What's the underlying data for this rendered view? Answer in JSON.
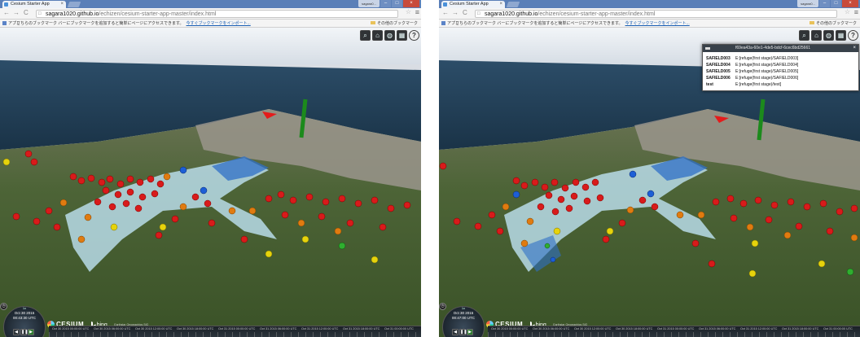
{
  "screens": [
    {
      "id": "left",
      "tab": {
        "title": "Cesium Starter App"
      },
      "window": {
        "user_label": "sagara0..."
      },
      "address": {
        "host": "sagara1020.github.io",
        "path": "/echizen/cesium-starter-app-master/index.html"
      },
      "bookmarks": {
        "apps": "アプリ",
        "message": "こちらのブックマーク バーにブックマークを追加すると簡単にページにアクセスできます。",
        "import_link": "今すぐブックマークをインポート...",
        "other": "その他のブックマーク"
      },
      "clock": {
        "speed": "1x",
        "date": "Oct 30 2015",
        "time": "00:43:30 UTC"
      },
      "credits": {
        "cesium": "CESIUM",
        "bing": "bing",
        "text": "Earthstar Geographics SIO"
      },
      "timeline_labels": [
        "Oct 30 2015 00:00:00 UTC",
        "Oct 30 2015 06:00:00 UTC",
        "Oct 30 2015 12:00:00 UTC",
        "Oct 30 2015 18:00:00 UTC",
        "Oct 31 2015 00:00:00 UTC",
        "Oct 31 2015 06:00:00 UTC",
        "Oct 31 2015 12:00:00 UTC",
        "Oct 31 2015 18:00:00 UTC",
        "Oct 31 00:00:00 UTC"
      ]
    },
    {
      "id": "right",
      "tab": {
        "title": "Cesium Starter App"
      },
      "window": {
        "user_label": "sagara0..."
      },
      "address": {
        "host": "sagara1020.github.io",
        "path": "/echizen/cesium-starter-app-master/index.html"
      },
      "bookmarks": {
        "apps": "アプリ",
        "message": "こちらのブックマーク バーにブックマークを追加すると簡単にページにアクセスできます。",
        "import_link": "今すぐブックマークをインポート...",
        "other": "その他のブックマーク"
      },
      "infobox": {
        "title": "f69ea43a-60e1-4de5-bdcf-6cec6bd25661",
        "rows": [
          {
            "key": "SAFIELD003",
            "value": "E:[refuge(first stage)/SAFIELD003]"
          },
          {
            "key": "SAFIELD004",
            "value": "E:[refuge(first stage)/SAFIELD004]"
          },
          {
            "key": "SAFIELD005",
            "value": "E:[refuge(first stage)/SAFIELD005]"
          },
          {
            "key": "SAFIELD006",
            "value": "E:[refuge(first stage)/SAFIELD006]"
          },
          {
            "key": "test",
            "value": "E:[refuge(first stage)/test]"
          }
        ]
      },
      "clock": {
        "speed": "1x",
        "date": "Oct 30 2015",
        "time": "00:47:00 UTC"
      },
      "credits": {
        "cesium": "CESIUM",
        "bing": "bing",
        "text": "Earthstar Geographics SIO"
      },
      "timeline_labels": [
        "Oct 30 2015 00:00:00 UTC",
        "Oct 30 2015 06:00:00 UTC",
        "Oct 30 2015 12:00:00 UTC",
        "Oct 30 2015 18:00:00 UTC",
        "Oct 31 2015 00:00:00 UTC",
        "Oct 31 2015 06:00:00 UTC",
        "Oct 31 2015 12:00:00 UTC",
        "Oct 31 2015 18:00:00 UTC",
        "Oct 31 00:00:00 UTC"
      ]
    }
  ],
  "toolbar_icons": [
    "search-icon",
    "home-icon",
    "globe-icon",
    "imagery-layers-icon",
    "help-icon"
  ],
  "colors": {
    "marker_red": "#d81b1b",
    "marker_orange": "#e07b10",
    "marker_yellow": "#e6d30c",
    "marker_green": "#2fae2f",
    "marker_blue": "#1d5fd6",
    "flood_light": "#bfe3f4",
    "flood_dark": "#2f6fc7",
    "sea": "#1f3f57",
    "urban": "#8d8a84",
    "forest": "#3d5a2a",
    "green_pole": "#1c8a1c",
    "arrow_red": "#e41b1b"
  }
}
